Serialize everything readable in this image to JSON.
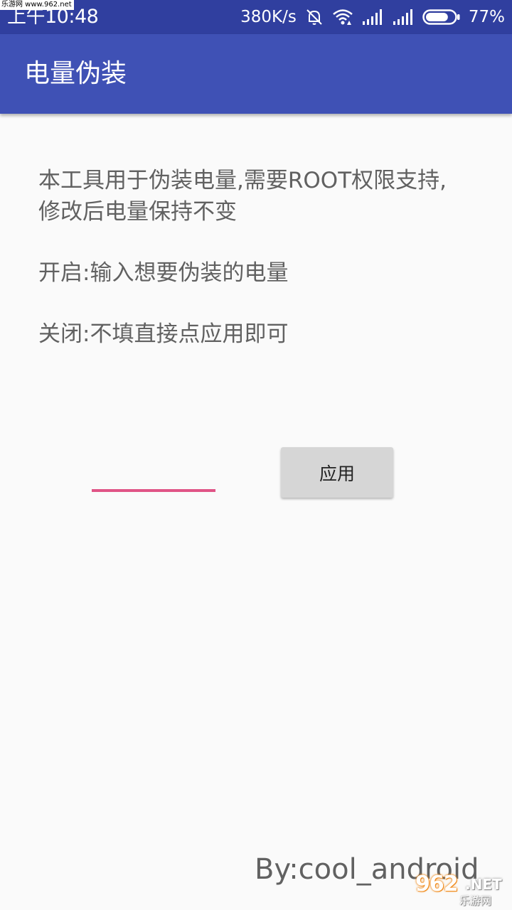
{
  "status_bar": {
    "time": "上午10:48",
    "net_speed": "380K/s",
    "battery_percent": "77%",
    "battery_level": 0.77,
    "icons": [
      "mute-icon",
      "wifi-icon",
      "signal-icon",
      "signal-icon",
      "battery-icon"
    ]
  },
  "watermark": {
    "top_text": "乐游网 www.962.net",
    "logo_main": "962",
    "logo_net": ".NET",
    "logo_sub": "乐游网"
  },
  "app_bar": {
    "title": "电量伪装"
  },
  "content": {
    "description": "本工具用于伪装电量,需要ROOT权限支持, 修改后电量保持不变",
    "enable_hint": "开启:输入想要伪装的电量",
    "disable_hint": "关闭:不填直接点应用即可"
  },
  "form": {
    "battery_input_value": "",
    "apply_label": "应用"
  },
  "footer": {
    "author": "By:cool_android"
  },
  "colors": {
    "status_bar": "#303f9f",
    "app_bar": "#3f51b5",
    "background": "#fafafa",
    "accent_underline": "#e05486",
    "button": "#d6d6d6",
    "body_text": "#616161"
  }
}
